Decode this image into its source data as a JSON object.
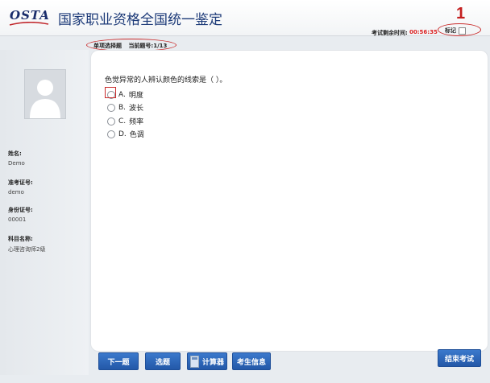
{
  "header": {
    "logo_text": "OSTA",
    "title": "国家职业资格全国统一鉴定",
    "timer_label": "考试剩余时间:",
    "timer_value": "00:56:35",
    "mark_label": "标记",
    "annotation_number": "1"
  },
  "question_bar": {
    "type_label": "单项选择题",
    "progress": "当前题号:1/13"
  },
  "candidate": {
    "fields": [
      {
        "label": "姓名:",
        "value": "Demo"
      },
      {
        "label": "准考证号:",
        "value": "demo"
      },
      {
        "label": "身份证号:",
        "value": "00001"
      },
      {
        "label": "科目名称:",
        "value": "心理咨询师2级"
      }
    ]
  },
  "question": {
    "text": "色觉异常的人辨认颜色的线索是（      ）。",
    "options": [
      {
        "letter": "A.",
        "text": "明度"
      },
      {
        "letter": "B.",
        "text": "波长"
      },
      {
        "letter": "C.",
        "text": "频率"
      },
      {
        "letter": "D.",
        "text": "色调"
      }
    ]
  },
  "buttons": {
    "next": "下一题",
    "select": "选题",
    "calculator": "计算器",
    "candidate_info": "考生信息",
    "finish": "结束考试"
  },
  "colors": {
    "primary_button": "#2d66b8",
    "timer": "#dd2222",
    "annotation": "#c92b2b"
  }
}
